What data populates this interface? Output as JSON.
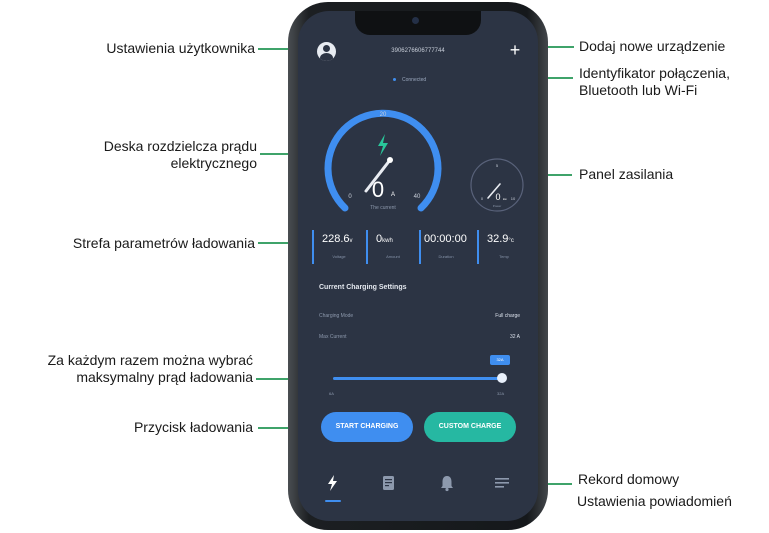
{
  "callouts": {
    "user_settings": "Ustawienia użytkownika",
    "add_device": "Dodaj nowe urządzenie",
    "connection_id_line1": "Identyfikator połączenia,",
    "connection_id_line2": "Bluetooth lub Wi-Fi",
    "dashboard_line1": "Deska rozdzielcza prądu",
    "dashboard_line2": "elektrycznego",
    "power_panel": "Panel zasilania",
    "charging_params": "Strefa parametrów ładowania",
    "max_current_line1": "Za każdym razem można wybrać",
    "max_current_line2": "maksymalny prąd ładowania",
    "charge_button": "Przycisk ładowania",
    "home_record": "Rekord domowy",
    "notification_settings": "Ustawienia powiadomień"
  },
  "app": {
    "device_id": "3906276606777744",
    "connection_status": "Connected",
    "gauge": {
      "max_top": "20",
      "min": "0",
      "max": "40",
      "value": "0",
      "unit": "A",
      "label": "The current"
    },
    "power_gauge": {
      "top": "5",
      "min": "0",
      "max": "10",
      "value": "0",
      "unit": "kw",
      "label": "Power"
    },
    "params": [
      {
        "value": "228.6",
        "unit": "v",
        "label": "Voltage"
      },
      {
        "value": "0",
        "unit": "kwh",
        "label": "Amount"
      },
      {
        "value": "00:00:00",
        "unit": "",
        "label": "Duration"
      },
      {
        "value": "32.9",
        "unit": "°c",
        "label": "Temp"
      }
    ],
    "settings_title": "Current Charging Settings",
    "charging_mode_label": "Charging Mode",
    "charging_mode_value": "Full charge",
    "max_current_label": "Max Current",
    "max_current_value": "32 A",
    "slider": {
      "min_label": "6A",
      "max_label": "32A",
      "bubble": "32A",
      "level_fraction": 1.0
    },
    "start_button": "START CHARGING",
    "custom_button": "CUSTOM CHARGE",
    "tabs": [
      "charging-bolt-icon",
      "records-icon",
      "bell-icon",
      "menu-icon"
    ]
  },
  "colors": {
    "screen_bg": "#2c3444",
    "accent_blue": "#3f8ef0",
    "accent_teal": "#26b8a2",
    "callout_line": "#3fa36a",
    "bolt_green": "#29c79a"
  }
}
